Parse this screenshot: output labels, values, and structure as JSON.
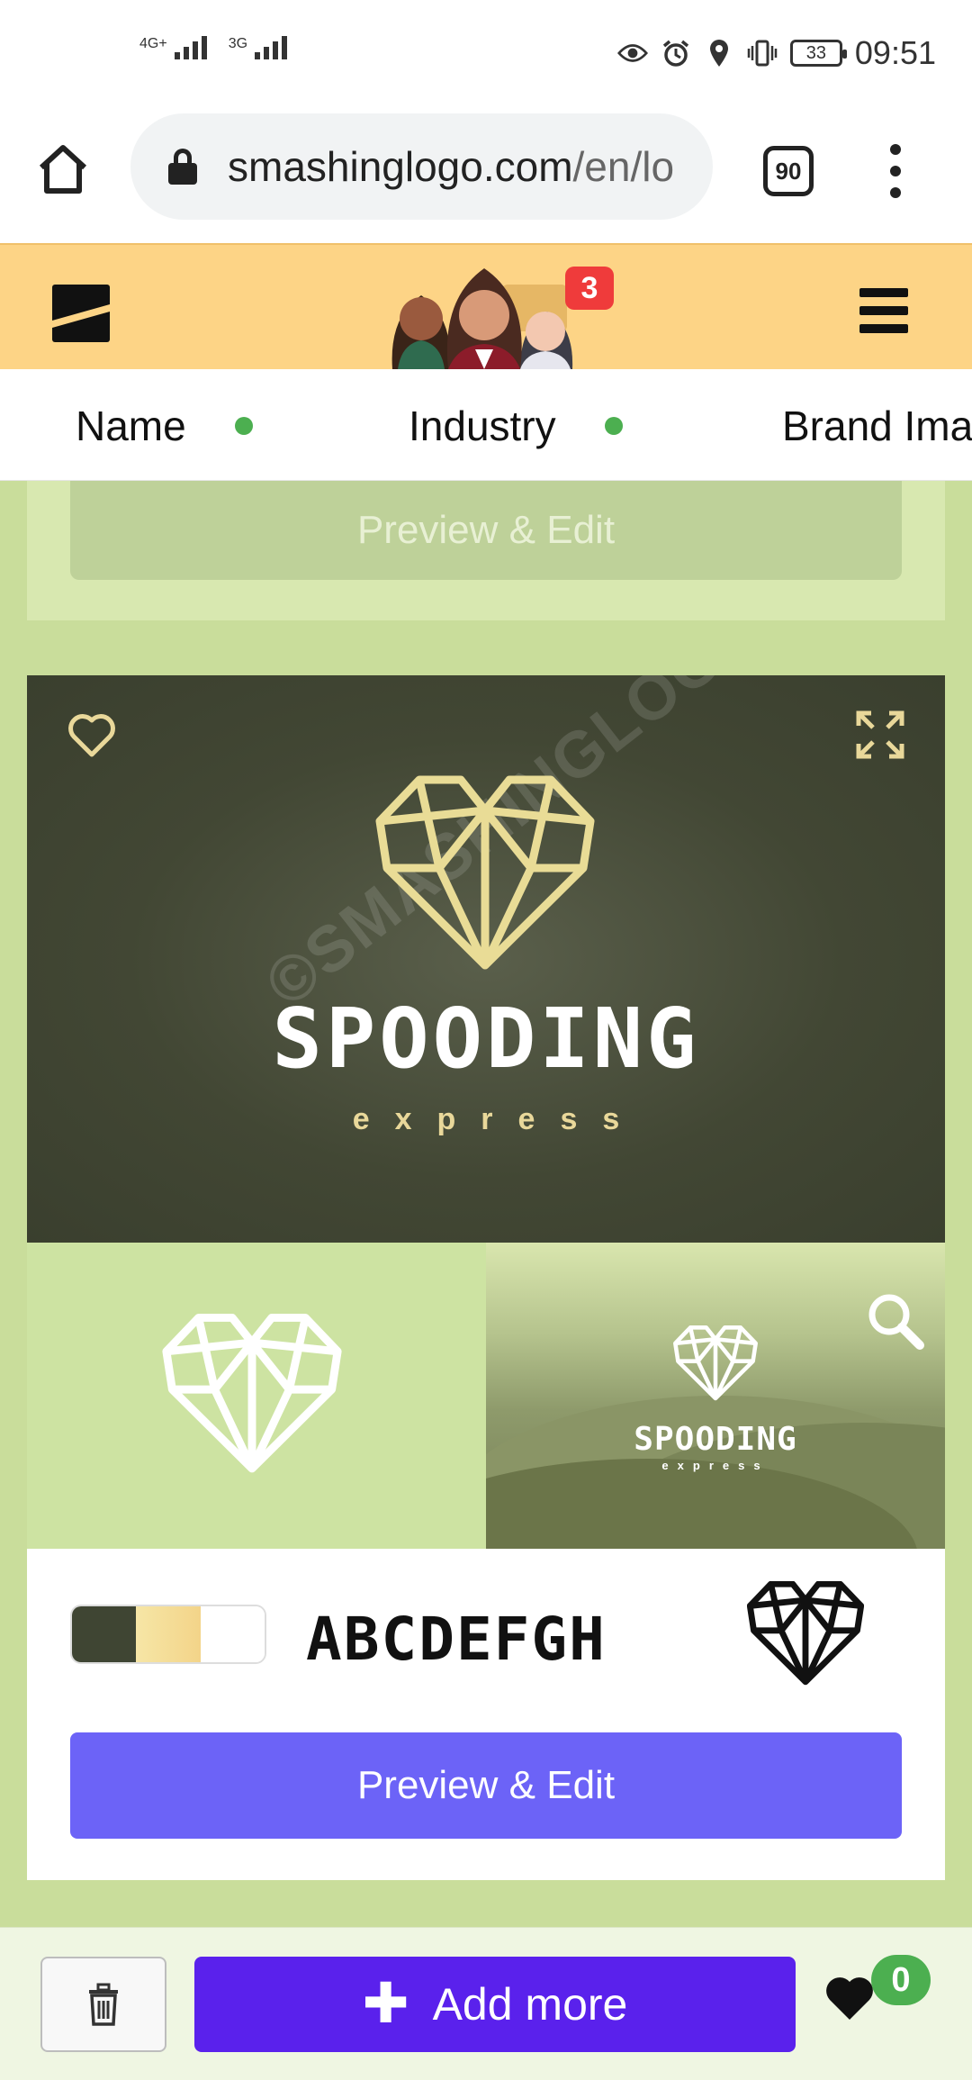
{
  "status_bar": {
    "signal_1": "4G+",
    "signal_2": "3G",
    "battery": "33",
    "time": "09:51"
  },
  "browser": {
    "url_domain": "smashinglogo.com",
    "url_path": "/en/lo",
    "tab_count": "90"
  },
  "site_header": {
    "notification_count": "3"
  },
  "steps_nav": {
    "items": [
      {
        "label": "Name"
      },
      {
        "label": "Industry"
      },
      {
        "label": "Brand Ima"
      }
    ]
  },
  "previous_card": {
    "button_label": "Preview & Edit"
  },
  "logo_card": {
    "brand_name": "SPOODING",
    "brand_sub": "express",
    "watermark": "©SMASHINGLOGO",
    "font_sample": "ABCDEFGH",
    "palette": [
      "#3f4533",
      "#f5d98c",
      "#ffffff"
    ],
    "button_label": "Preview & Edit",
    "icons": {
      "favorite": "heart-outline-icon",
      "expand": "expand-icon",
      "zoom": "search-icon"
    }
  },
  "bottom_bar": {
    "add_more_label": "Add more",
    "favorites_count": "0"
  },
  "colors": {
    "header_bg": "#fdd486",
    "page_bg": "#c9dd9b",
    "accent_purple": "#6c63f7",
    "add_more_purple": "#5a21ec",
    "status_green": "#4caf50",
    "badge_red": "#ef3b3b"
  }
}
